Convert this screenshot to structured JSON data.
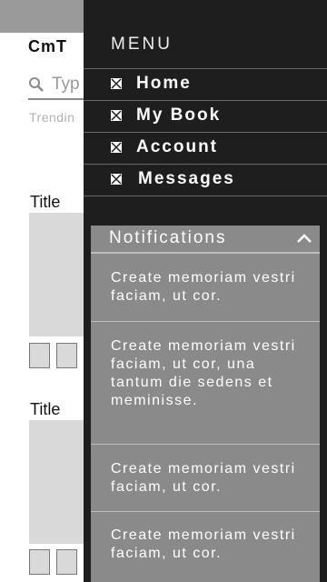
{
  "app": {
    "brand": "CmT"
  },
  "search": {
    "placeholder": "Typ"
  },
  "trending": {
    "label": "Trendin"
  },
  "cards": [
    {
      "title": "Title"
    },
    {
      "title": "Title"
    }
  ],
  "menu": {
    "title": "MENU",
    "items": [
      {
        "label": "Home",
        "icon": "image-placeholder-icon"
      },
      {
        "label": "My Book",
        "icon": "image-placeholder-icon"
      },
      {
        "label": "Account",
        "icon": "image-placeholder-icon"
      },
      {
        "label": "Messages",
        "icon": "image-placeholder-icon"
      }
    ]
  },
  "notifications": {
    "title": "Notifications",
    "toggle_icon": "chevron-up-icon",
    "items": [
      {
        "text": "Create memoriam vestri faciam, ut cor."
      },
      {
        "text": "Create memoriam vestri faciam, ut cor, una tantum die sedens et meminisse."
      },
      {
        "text": "Create memoriam vestri faciam, ut cor."
      },
      {
        "text": "Create memoriam vestri faciam, ut cor."
      }
    ]
  },
  "colors": {
    "drawer_bg": "#1e1e1e",
    "notifications_bg": "#8a8a8a",
    "topbar": "#9a9a9a",
    "placeholder": "#d9d9d9"
  }
}
